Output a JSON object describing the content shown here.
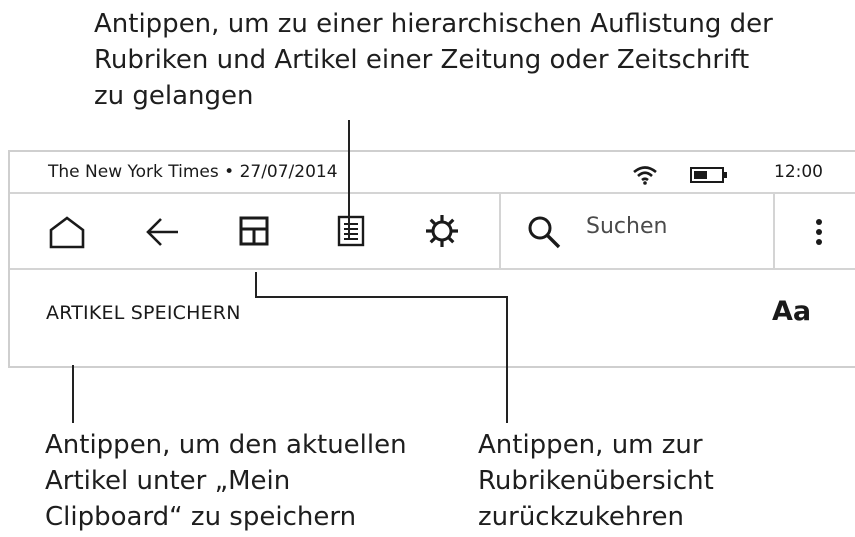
{
  "callouts": {
    "top": [
      "Antippen, um zu einer hierarchischen Auflistung der",
      "Rubriken und Artikel einer Zeitung oder Zeitschrift",
      "zu gelangen"
    ],
    "left": [
      "Antippen, um den aktuellen",
      "Artikel unter „Mein",
      "Clipboard“ zu speichern"
    ],
    "right": [
      "Antippen, um zur",
      "Rubrikenübersicht",
      "zurückzukehren"
    ]
  },
  "status_bar": {
    "title": "The New York Times • 27/07/2014",
    "time": "12:00"
  },
  "toolbar": {
    "icons": [
      "home-icon",
      "back-arrow-icon",
      "sections-grid-icon",
      "article-list-icon",
      "settings-gear-icon",
      "search-icon",
      "more-menu-icon"
    ],
    "search_label": "Suchen"
  },
  "actions": {
    "save_article_label": "ARTIKEL SPEICHERN",
    "font_button_label": "Aa"
  },
  "colors": {
    "text": "#1a1a1a",
    "divider": "#d4d4d4"
  }
}
